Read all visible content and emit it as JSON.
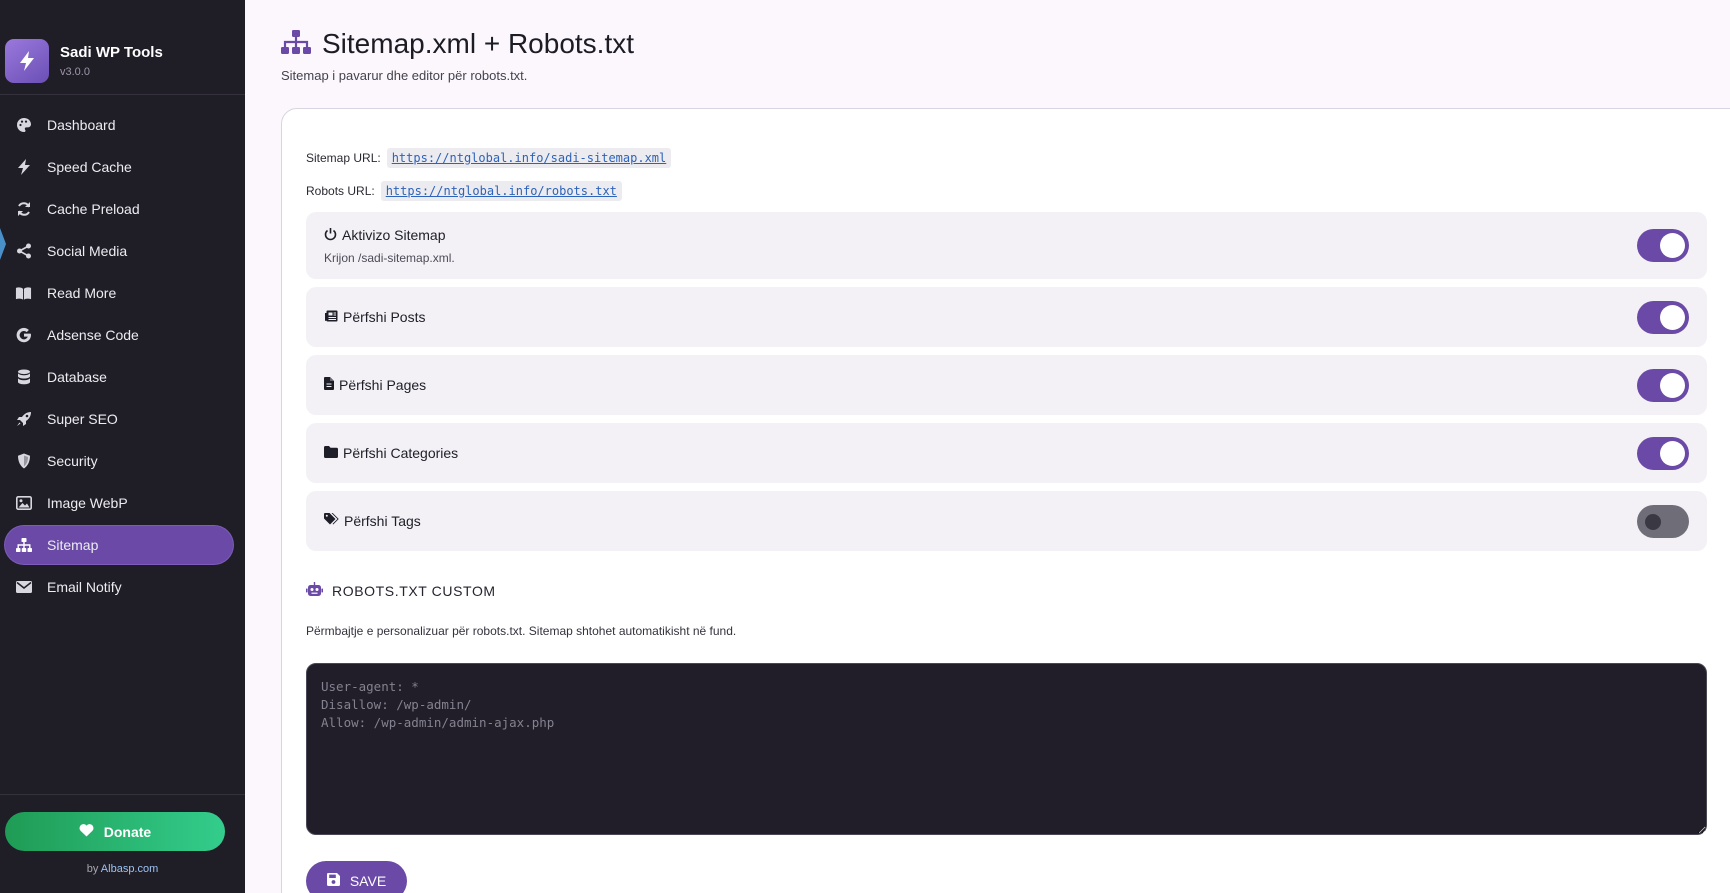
{
  "sidebar": {
    "brand": {
      "name": "Sadi WP Tools",
      "version": "v3.0.0"
    },
    "items": [
      {
        "label": "Dashboard",
        "icon": "palette-icon"
      },
      {
        "label": "Speed Cache",
        "icon": "bolt-icon"
      },
      {
        "label": "Cache Preload",
        "icon": "refresh-icon"
      },
      {
        "label": "Social Media",
        "icon": "share-icon"
      },
      {
        "label": "Read More",
        "icon": "book-icon"
      },
      {
        "label": "Adsense Code",
        "icon": "google-icon"
      },
      {
        "label": "Database",
        "icon": "database-icon"
      },
      {
        "label": "Super SEO",
        "icon": "rocket-icon"
      },
      {
        "label": "Security",
        "icon": "shield-icon"
      },
      {
        "label": "Image WebP",
        "icon": "image-icon"
      },
      {
        "label": "Sitemap",
        "icon": "sitemap-icon",
        "active": true
      },
      {
        "label": "Email Notify",
        "icon": "envelope-icon"
      }
    ],
    "donate_label": "Donate",
    "by_prefix": "by",
    "by_link": "Albasp.com"
  },
  "page": {
    "title": "Sitemap.xml + Robots.txt",
    "subtitle": "Sitemap i pavarur dhe editor për robots.txt."
  },
  "urls": {
    "sitemap_label": "Sitemap URL:",
    "sitemap_url": "https://ntglobal.info/sadi-sitemap.xml",
    "robots_label": "Robots URL:",
    "robots_url": "https://ntglobal.info/robots.txt"
  },
  "options": [
    {
      "label": "Aktivizo Sitemap",
      "desc": "Krijon /sadi-sitemap.xml.",
      "icon": "power-icon",
      "on": true
    },
    {
      "label": "Përfshi Posts",
      "icon": "newspaper-icon",
      "on": true
    },
    {
      "label": "Përfshi Pages",
      "icon": "file-icon",
      "on": true
    },
    {
      "label": "Përfshi Categories",
      "icon": "folder-icon",
      "on": true
    },
    {
      "label": "Përfshi Tags",
      "icon": "tags-icon",
      "on": false
    }
  ],
  "robots": {
    "section_title": "ROBOTS.TXT CUSTOM",
    "help": "Përmbajtje e personalizuar për robots.txt. Sitemap shtohet automatikisht në fund.",
    "placeholder": "User-agent: *\nDisallow: /wp-admin/\nAllow: /wp-admin/admin-ajax.php",
    "save_label": "SAVE"
  },
  "colors": {
    "accent": "#6a4aa6",
    "sidebar_bg": "#1f1d26",
    "donate_start": "#1f9b55",
    "donate_end": "#33cd8c"
  }
}
